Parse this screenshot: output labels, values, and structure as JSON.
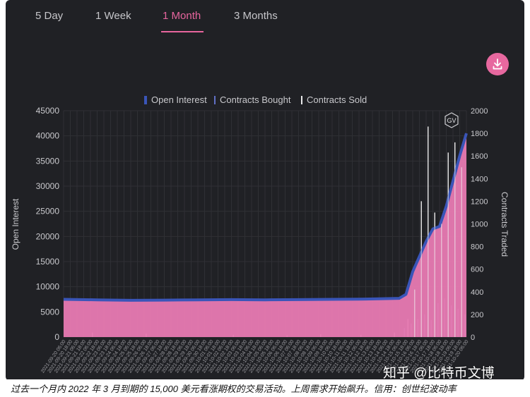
{
  "tabs": [
    {
      "label": "5 Day",
      "active": false
    },
    {
      "label": "1 Week",
      "active": false
    },
    {
      "label": "1 Month",
      "active": true
    },
    {
      "label": "3 Months",
      "active": false
    }
  ],
  "download_icon": "download-icon",
  "gv_logo": "GV",
  "colors": {
    "background": "#202125",
    "accent": "#e7659e",
    "open_interest_line": "#3a55b8",
    "contracts_bought": "#6170c6",
    "contracts_sold": "#e9e9ea",
    "area_fill": "#e87ab2"
  },
  "chart_data": {
    "type": "area",
    "legend": [
      "Open Interest",
      "Contracts Bought",
      "Contracts Sold"
    ],
    "legend_placement": "top-center",
    "ylabel_left": "Open Interest",
    "ylabel_right": "Contracts Traded",
    "ylim_left": [
      0,
      45000
    ],
    "ylim_right": [
      0,
      2000
    ],
    "yticks_left": [
      0,
      5000,
      10000,
      15000,
      20000,
      25000,
      30000,
      35000,
      40000,
      45000
    ],
    "yticks_right": [
      0,
      200,
      400,
      600,
      800,
      1000,
      1200,
      1400,
      1600,
      1800,
      2000
    ],
    "grid": true,
    "x_tick_labels": [
      "2021-09-20 06:00",
      "2021-09-20 18:00",
      "2021-09-21 06:00",
      "2021-09-21 18:00",
      "2021-09-22 06:00",
      "2021-09-22 18:00",
      "2021-09-23 06:00",
      "2021-09-23 18:00",
      "2021-09-24 06:00",
      "2021-09-24 18:00",
      "2021-09-25 06:00",
      "2021-09-25 18:00",
      "2021-09-26 06:00",
      "2021-09-26 18:00",
      "2021-09-27 06:00",
      "2021-09-27 18:00",
      "2021-09-28 06:00",
      "2021-09-28 18:00",
      "2021-09-29 06:00",
      "2021-09-29 18:00",
      "2021-09-30 06:00",
      "2021-09-30 18:00",
      "2021-10-01 06:00",
      "2021-10-01 18:00",
      "2021-10-02 06:00",
      "2021-10-02 18:00",
      "2021-10-03 06:00",
      "2021-10-03 18:00",
      "2021-10-04 06:00",
      "2021-10-04 18:00",
      "2021-10-05 06:00",
      "2021-10-05 18:00",
      "2021-10-06 06:00",
      "2021-10-06 18:00",
      "2021-10-07 06:00",
      "2021-10-07 18:00",
      "2021-10-08 06:00",
      "2021-10-08 18:00",
      "2021-10-09 06:00",
      "2021-10-09 18:00",
      "2021-10-10 06:00",
      "2021-10-10 18:00",
      "2021-10-11 06:00",
      "2021-10-11 18:00",
      "2021-10-12 06:00",
      "2021-10-12 18:00",
      "2021-10-13 06:00",
      "2021-10-13 18:00",
      "2021-10-14 06:00",
      "2021-10-14 18:00",
      "2021-10-15 06:00",
      "2021-10-15 18:00",
      "2021-10-16 06:00",
      "2021-10-16 18:00",
      "2021-10-17 06:00",
      "2021-10-17 18:00",
      "2021-10-18 06:00",
      "2021-10-18 18:00",
      "2021-10-19 06:00",
      "2021-10-19 18:00",
      "2021-10-20 06:00"
    ],
    "open_interest": {
      "x_index": [
        0,
        5,
        10,
        15,
        20,
        25,
        30,
        35,
        40,
        45,
        50,
        51,
        52,
        53,
        54,
        55,
        56,
        57,
        58,
        59,
        60
      ],
      "values": [
        7500,
        7400,
        7300,
        7350,
        7400,
        7450,
        7400,
        7450,
        7500,
        7550,
        7700,
        8500,
        13000,
        16000,
        19000,
        21500,
        22000,
        26000,
        31000,
        36000,
        40500
      ]
    },
    "contracts_sold": {
      "x_index": [
        4,
        12,
        25,
        33,
        38,
        44,
        49,
        51,
        52,
        53,
        54,
        55,
        56,
        57,
        58,
        59
      ],
      "values": [
        40,
        30,
        20,
        15,
        25,
        20,
        40,
        160,
        420,
        1200,
        1860,
        1100,
        1000,
        1630,
        1720,
        1500
      ]
    },
    "contracts_bought": {
      "x_index": [
        51,
        52,
        53,
        54,
        55,
        56,
        57,
        58,
        59,
        60
      ],
      "values": [
        80,
        120,
        160,
        200,
        150,
        300,
        340,
        280,
        250,
        200
      ]
    }
  },
  "caption": "过去一个月内 2022 年 3 月到期的 15,000 美元看涨期权的交易活动。上周需求开始飙升。信用：创世纪波动率",
  "watermark": "知乎 @比特币文博"
}
